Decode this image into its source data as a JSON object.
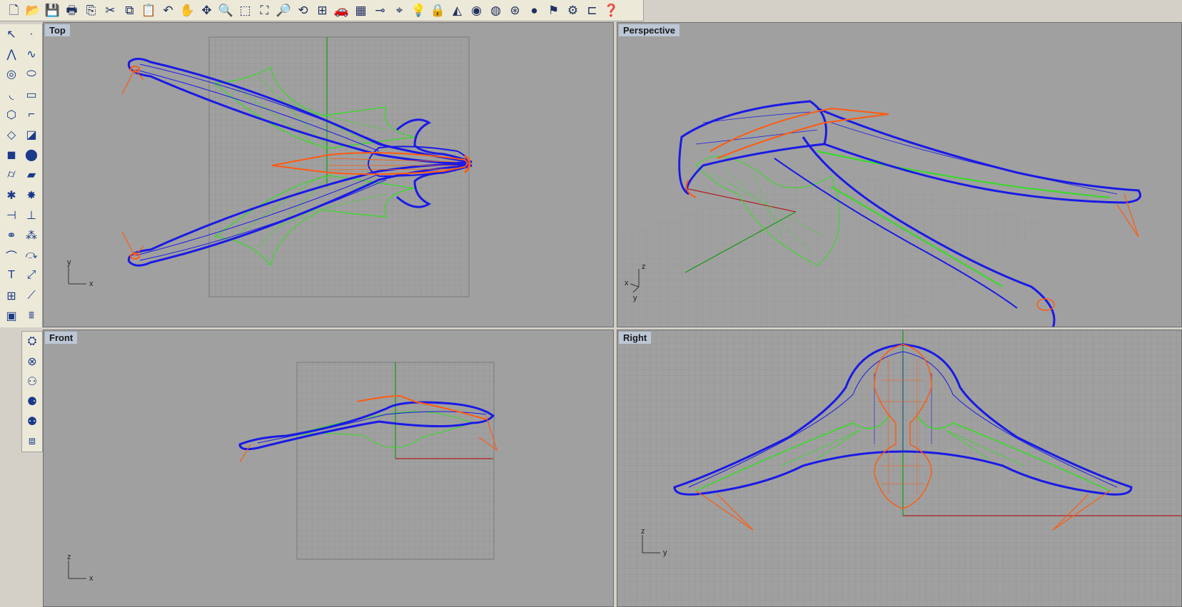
{
  "toolbar": {
    "icons": [
      {
        "name": "new-file-icon",
        "glyph": "🗋"
      },
      {
        "name": "open-folder-icon",
        "glyph": "📂"
      },
      {
        "name": "save-icon",
        "glyph": "💾"
      },
      {
        "name": "print-icon",
        "glyph": "🖶"
      },
      {
        "name": "export-icon",
        "glyph": "⎘"
      },
      {
        "name": "cut-icon",
        "glyph": "✂"
      },
      {
        "name": "copy-icon",
        "glyph": "⧉"
      },
      {
        "name": "paste-icon",
        "glyph": "📋"
      },
      {
        "name": "undo-icon",
        "glyph": "↶"
      },
      {
        "name": "pan-hand-icon",
        "glyph": "✋"
      },
      {
        "name": "rotate-view-icon",
        "glyph": "✥"
      },
      {
        "name": "zoom-icon",
        "glyph": "🔍"
      },
      {
        "name": "zoom-window-icon",
        "glyph": "⬚"
      },
      {
        "name": "zoom-extents-icon",
        "glyph": "⛶"
      },
      {
        "name": "zoom-selected-icon",
        "glyph": "🔎"
      },
      {
        "name": "undo-view-icon",
        "glyph": "⟲"
      },
      {
        "name": "four-viewports-icon",
        "glyph": "⊞"
      },
      {
        "name": "car-object-icon",
        "glyph": "🚗"
      },
      {
        "name": "grid-plane-icon",
        "glyph": "▦"
      },
      {
        "name": "distance-icon",
        "glyph": "⊸"
      },
      {
        "name": "osnap-icon",
        "glyph": "⌖"
      },
      {
        "name": "light-bulb-icon",
        "glyph": "💡"
      },
      {
        "name": "lock-icon",
        "glyph": "🔒"
      },
      {
        "name": "layers-icon",
        "glyph": "◭"
      },
      {
        "name": "color-wheel-icon",
        "glyph": "◉"
      },
      {
        "name": "wireframe-sphere-icon",
        "glyph": "◍"
      },
      {
        "name": "ghosted-sphere-icon",
        "glyph": "⊛"
      },
      {
        "name": "render-sphere-icon",
        "glyph": "●"
      },
      {
        "name": "flag-icon",
        "glyph": "⚑"
      },
      {
        "name": "settings-gear-icon",
        "glyph": "⚙"
      },
      {
        "name": "hierarchy-icon",
        "glyph": "⊏"
      },
      {
        "name": "help-icon",
        "glyph": "❓"
      }
    ]
  },
  "left_tools": {
    "icons": [
      {
        "name": "select-arrow-icon",
        "glyph": "↖"
      },
      {
        "name": "point-icon",
        "glyph": "·"
      },
      {
        "name": "polyline-icon",
        "glyph": "⋀"
      },
      {
        "name": "curve-icon",
        "glyph": "∿"
      },
      {
        "name": "circle-icon",
        "glyph": "◎"
      },
      {
        "name": "ellipse-icon",
        "glyph": "⬭"
      },
      {
        "name": "arc-icon",
        "glyph": "◟"
      },
      {
        "name": "rectangle-icon",
        "glyph": "▭"
      },
      {
        "name": "polygon-icon",
        "glyph": "⬡"
      },
      {
        "name": "fillet-curve-icon",
        "glyph": "⌐"
      },
      {
        "name": "surface-icon",
        "glyph": "◇"
      },
      {
        "name": "extrude-surface-icon",
        "glyph": "◪"
      },
      {
        "name": "box-icon",
        "glyph": "◼"
      },
      {
        "name": "sphere-icon",
        "glyph": "⬤"
      },
      {
        "name": "cylinder-icon",
        "glyph": "⌭"
      },
      {
        "name": "mesh-plane-icon",
        "glyph": "▰"
      },
      {
        "name": "boolean-icon",
        "glyph": "✱"
      },
      {
        "name": "explode-icon",
        "glyph": "✸"
      },
      {
        "name": "trim-icon",
        "glyph": "⊣"
      },
      {
        "name": "split-icon",
        "glyph": "⊥"
      },
      {
        "name": "join-icon",
        "glyph": "⚭"
      },
      {
        "name": "group-icon",
        "glyph": "⁂"
      },
      {
        "name": "fillet-icon",
        "glyph": "⌒"
      },
      {
        "name": "offset-icon",
        "glyph": "⤼"
      },
      {
        "name": "text-icon",
        "glyph": "T"
      },
      {
        "name": "scale-icon",
        "glyph": "⤢"
      },
      {
        "name": "array-icon",
        "glyph": "⊞"
      },
      {
        "name": "dimension-icon",
        "glyph": "⟋"
      },
      {
        "name": "block-icon",
        "glyph": "▣"
      },
      {
        "name": "analyze-icon",
        "glyph": "⩩"
      }
    ]
  },
  "left_tools2": {
    "icons": [
      {
        "name": "render-camera-icon",
        "glyph": "⛭"
      },
      {
        "name": "render-stop-icon",
        "glyph": "⊗"
      },
      {
        "name": "render-settings-icon",
        "glyph": "⚇"
      },
      {
        "name": "render-material-icon",
        "glyph": "⚈"
      },
      {
        "name": "render-light-icon",
        "glyph": "⚉"
      },
      {
        "name": "render-window-icon",
        "glyph": "⧈"
      }
    ]
  },
  "viewports": {
    "top": {
      "label": "Top",
      "axis_h": "x",
      "axis_v": "y"
    },
    "perspective": {
      "label": "Perspective",
      "axis_h": "x",
      "axis_v": "z",
      "axis_d": "y"
    },
    "front": {
      "label": "Front",
      "axis_h": "x",
      "axis_v": "z"
    },
    "right": {
      "label": "Right",
      "axis_h": "y",
      "axis_v": "z"
    }
  },
  "colors": {
    "viewport_bg": "#a0a0a0",
    "grid": "#8a8a8a",
    "wire_blue": "#1a1ae6",
    "wire_green": "#33dd22",
    "wire_orange": "#ff5a10",
    "axis_red": "#b02020",
    "axis_green": "#119911"
  }
}
